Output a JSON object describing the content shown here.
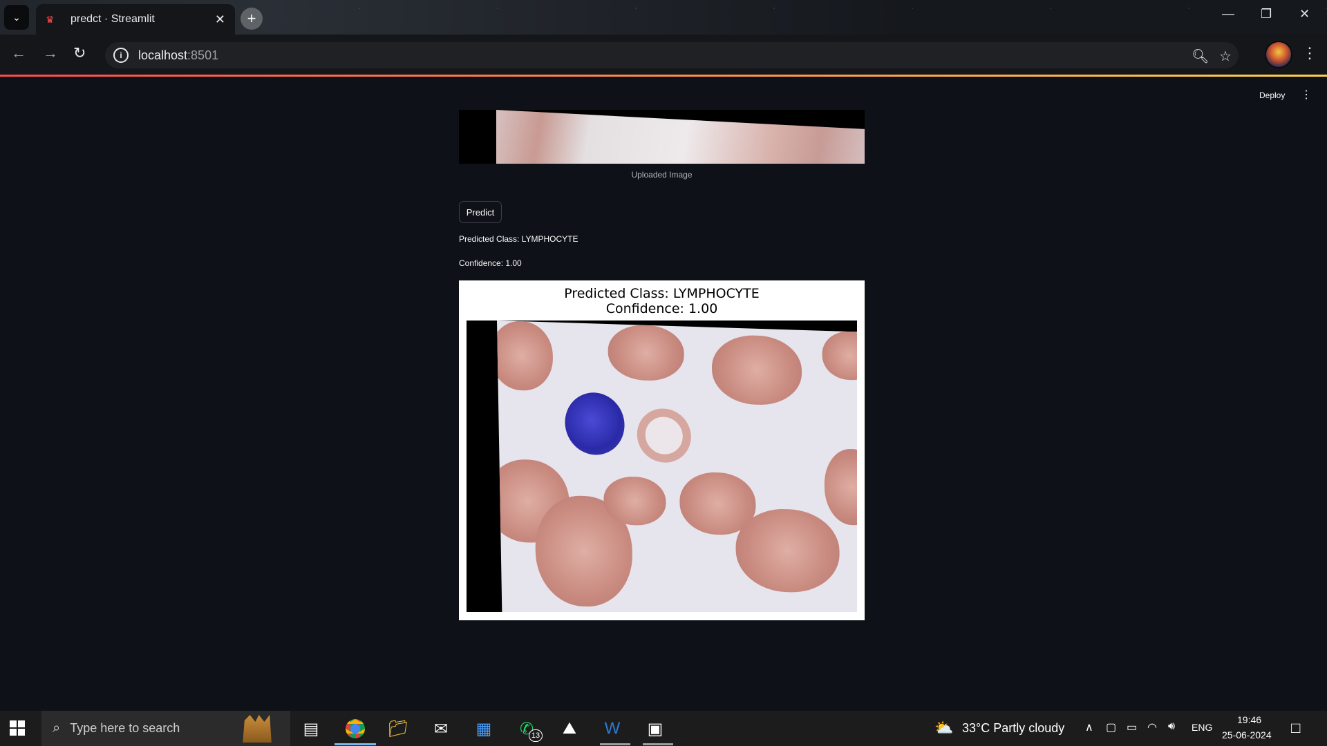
{
  "browser": {
    "tab_title": "predct · Streamlit",
    "url_host": "localhost",
    "url_port": ":8501"
  },
  "streamlit": {
    "deploy_label": "Deploy",
    "image_caption": "Uploaded Image",
    "predict_button": "Predict",
    "predicted_class_text": "Predicted Class: LYMPHOCYTE",
    "confidence_text": "Confidence: 1.00",
    "figure_title_line1": "Predicted Class: LYMPHOCYTE",
    "figure_title_line2": "Confidence: 1.00"
  },
  "taskbar": {
    "search_placeholder": "Type here to search",
    "whatsapp_badge": "13",
    "weather": "33°C  Partly cloudy",
    "language": "ENG",
    "time": "19:46",
    "date": "25-06-2024"
  },
  "colors": {
    "app_background": "#0e1117",
    "accent": "#ff4b4b"
  }
}
